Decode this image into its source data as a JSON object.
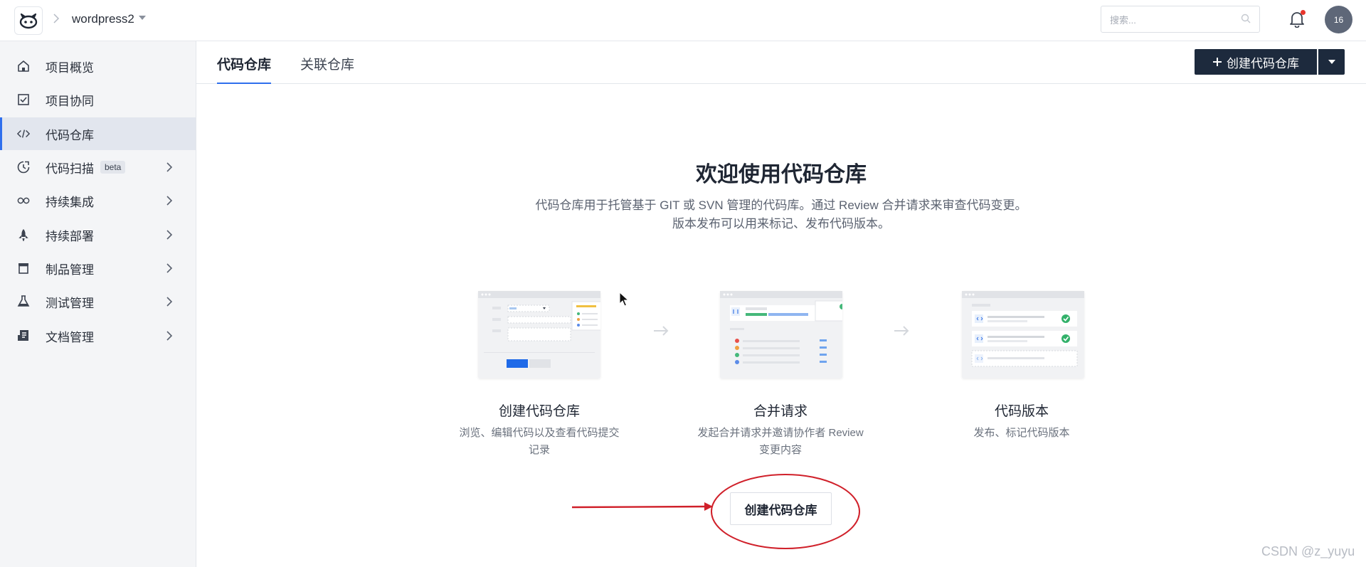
{
  "header": {
    "project_name": "wordpress2",
    "search_placeholder": "搜索...",
    "avatar_text": "16",
    "icons": [
      "logo-icon",
      "chevron-right-icon",
      "caret-down-icon",
      "search-icon",
      "bell-icon"
    ]
  },
  "sidebar": {
    "items": [
      {
        "label": "项目概览",
        "icon": "home-icon"
      },
      {
        "label": "项目协同",
        "icon": "checkbox-icon"
      },
      {
        "label": "代码仓库",
        "icon": "code-icon",
        "active": true
      },
      {
        "label": "代码扫描",
        "icon": "scan-icon",
        "badge": "beta"
      },
      {
        "label": "持续集成",
        "icon": "infinity-icon"
      },
      {
        "label": "持续部署",
        "icon": "rocket-icon"
      },
      {
        "label": "制品管理",
        "icon": "package-icon"
      },
      {
        "label": "测试管理",
        "icon": "flask-icon"
      },
      {
        "label": "文档管理",
        "icon": "document-icon"
      }
    ]
  },
  "tabs": [
    {
      "label": "代码仓库",
      "active": true
    },
    {
      "label": "关联仓库",
      "active": false
    }
  ],
  "toolbar": {
    "create_label": "创建代码仓库"
  },
  "welcome": {
    "title": "欢迎使用代码仓库",
    "desc_line1": "代码仓库用于托管基于 GIT 或 SVN 管理的代码库。通过 Review 合并请求来审查代码变更。",
    "desc_line2": "版本发布可以用来标记、发布代码版本。",
    "features": [
      {
        "title": "创建代码仓库",
        "desc_line1": "浏览、编辑代码以及查看代码提交",
        "desc_line2": "记录"
      },
      {
        "title": "合并请求",
        "desc_line1": "发起合并请求并邀请协作者 Review",
        "desc_line2": "变更内容"
      },
      {
        "title": "代码版本",
        "desc_line1": "发布、标记代码版本",
        "desc_line2": ""
      }
    ],
    "create_button": "创建代码仓库"
  },
  "colors": {
    "accent": "#2f6fed",
    "primary_button": "#1d2a3d",
    "annotation": "#d0202a"
  },
  "watermark": "CSDN @z_yuyu"
}
